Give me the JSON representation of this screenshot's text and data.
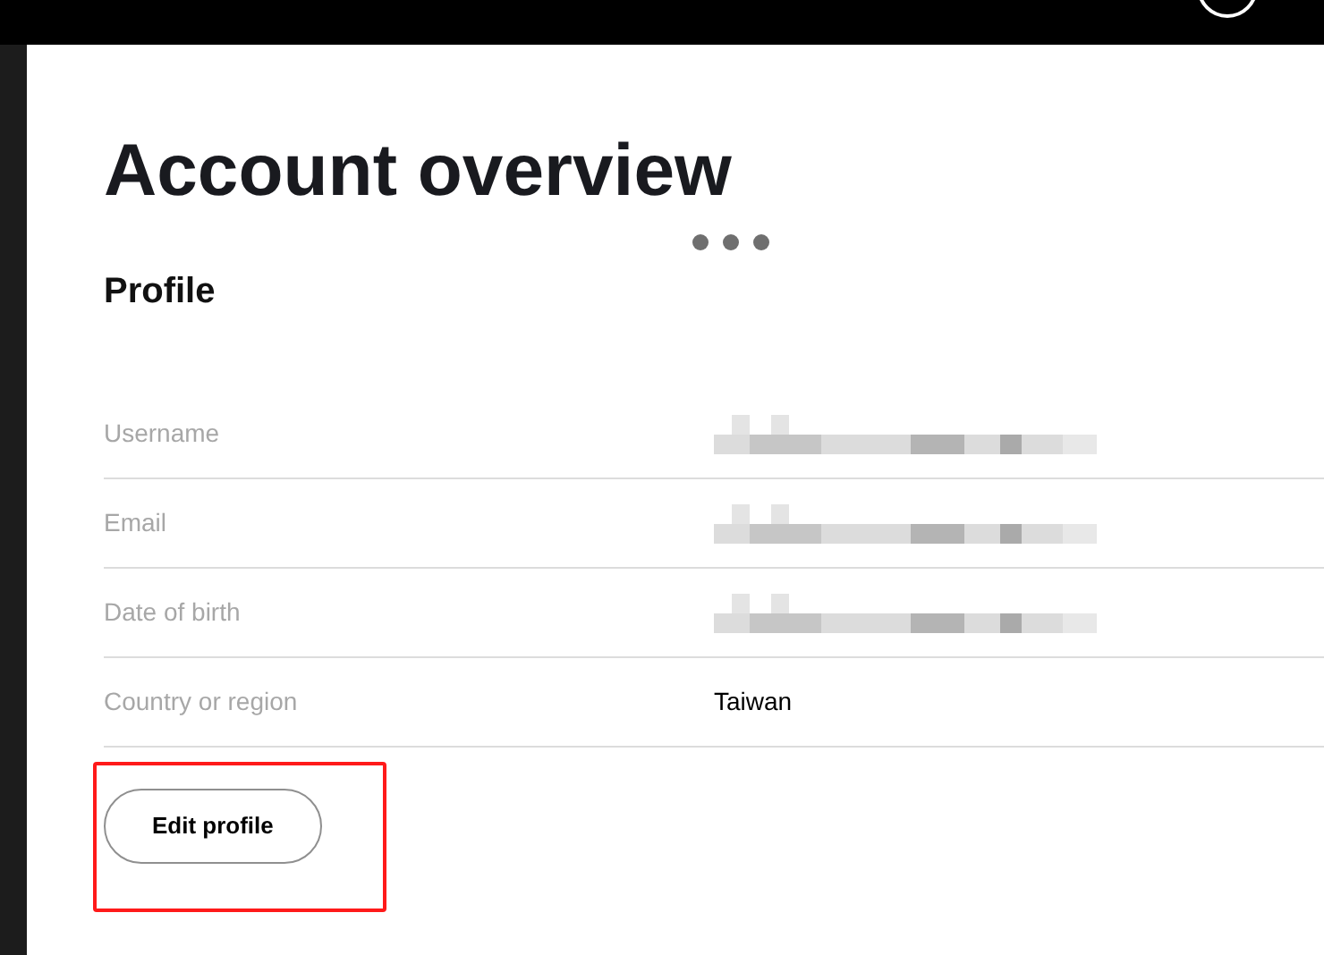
{
  "title": "Account overview",
  "loading": {
    "kind": "dots"
  },
  "profile": {
    "heading": "Profile",
    "rows": [
      {
        "label": "Username",
        "kind": "redacted"
      },
      {
        "label": "Email",
        "kind": "redacted"
      },
      {
        "label": "Date of birth",
        "kind": "redacted"
      },
      {
        "label": "Country or region",
        "kind": "text",
        "value": "Taiwan"
      }
    ],
    "button": "Edit profile",
    "highlighted": true
  }
}
